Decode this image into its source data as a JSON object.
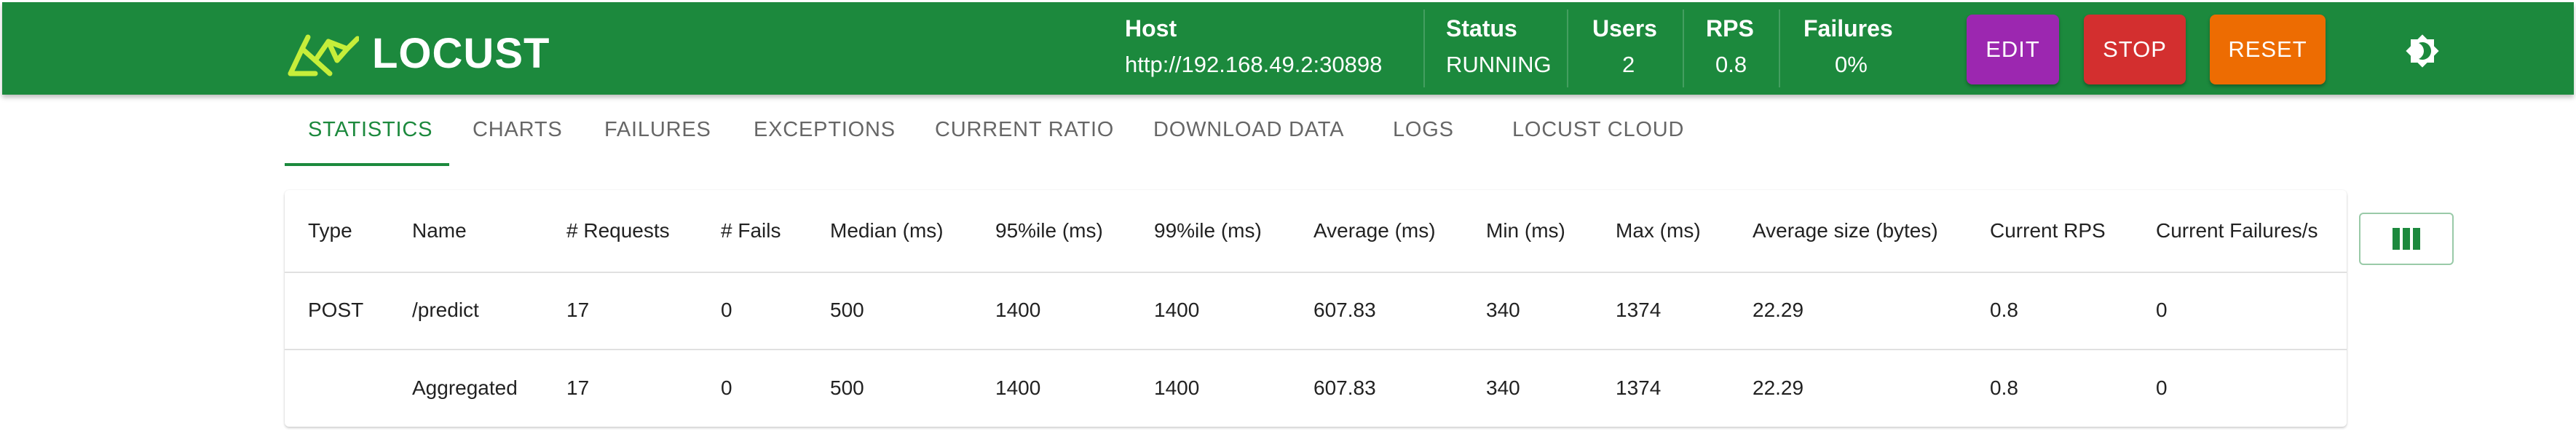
{
  "app": {
    "logo_text": "LOCUST"
  },
  "header": {
    "host_label": "Host",
    "host_value": "http://192.168.49.2:30898",
    "status_label": "Status",
    "status_value": "RUNNING",
    "users_label": "Users",
    "users_value": "2",
    "rps_label": "RPS",
    "rps_value": "0.8",
    "failures_label": "Failures",
    "failures_value": "0%",
    "edit_label": "EDIT",
    "stop_label": "STOP",
    "reset_label": "RESET",
    "theme_icon": "brightness-icon"
  },
  "colors": {
    "brand": "#1c893d",
    "edit": "#9c27b0",
    "stop": "#d32f2f",
    "reset": "#ed6c02"
  },
  "tabs": [
    {
      "label": "STATISTICS",
      "active": true
    },
    {
      "label": "CHARTS",
      "active": false
    },
    {
      "label": "FAILURES",
      "active": false
    },
    {
      "label": "EXCEPTIONS",
      "active": false
    },
    {
      "label": "CURRENT RATIO",
      "active": false
    },
    {
      "label": "DOWNLOAD DATA",
      "active": false
    },
    {
      "label": "LOGS",
      "active": false
    },
    {
      "label": "LOCUST CLOUD",
      "active": false
    }
  ],
  "table": {
    "columns": [
      "Type",
      "Name",
      "# Requests",
      "# Fails",
      "Median (ms)",
      "95%ile (ms)",
      "99%ile (ms)",
      "Average (ms)",
      "Min (ms)",
      "Max (ms)",
      "Average size (bytes)",
      "Current RPS",
      "Current Failures/s"
    ],
    "rows": [
      [
        "POST",
        "/predict",
        "17",
        "0",
        "500",
        "1400",
        "1400",
        "607.83",
        "340",
        "1374",
        "22.29",
        "0.8",
        "0"
      ],
      [
        "",
        "Aggregated",
        "17",
        "0",
        "500",
        "1400",
        "1400",
        "607.83",
        "340",
        "1374",
        "22.29",
        "0.8",
        "0"
      ]
    ],
    "column_selector_icon": "view-column-icon"
  }
}
